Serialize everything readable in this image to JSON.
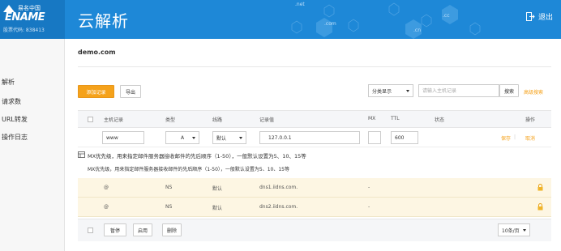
{
  "header": {
    "brand_cn": "易名中国",
    "brand_en": "ENAME",
    "stock_code": "股票代码: 838413",
    "title": "云解析",
    "deco_labels": [
      ".net",
      ".com",
      ".cc",
      ".cn"
    ],
    "logout_label": "退出",
    "bg_color": "#1e88d7"
  },
  "sidebar": {
    "items": [
      {
        "label": "解析"
      },
      {
        "label": "请求数"
      },
      {
        "label": "URL转发"
      },
      {
        "label": "操作日志"
      }
    ]
  },
  "main": {
    "domain": "demo.com",
    "toolbar": {
      "add_label": "添加记录",
      "export_label": "导出",
      "group_select": "分类显示",
      "search_placeholder": "请输入主机记录",
      "search_label": "搜索",
      "advanced_label": "高级搜索"
    },
    "columns": [
      "主机记录",
      "类型",
      "线路",
      "记录值",
      "MX",
      "TTL",
      "状态",
      "操作"
    ],
    "edit_row": {
      "host": "www",
      "type": "A",
      "line": "默认",
      "value": "127.0.0.1",
      "mx": "",
      "ttl": "600",
      "save_label": "保存",
      "cancel_label": "取消"
    },
    "hints": {
      "line1": "MX优先级，用来指定邮件服务器接收邮件的先后顺序（1-50），一般默认设置为5、10、15等",
      "line2": "MX优先级，用来指定邮件服务器接收邮件的先后顺序（1-50），一般默认设置为5、10、15等"
    },
    "rows": [
      {
        "host": "@",
        "type": "NS",
        "line": "默认",
        "value": "dns1.iidns.com.",
        "mx": "-"
      },
      {
        "host": "@",
        "type": "NS",
        "line": "默认",
        "value": "dns2.iidns.com.",
        "mx": "-"
      }
    ],
    "footer": {
      "pause_label": "暂停",
      "enable_label": "启用",
      "delete_label": "删除",
      "page_size": "10条/页"
    }
  },
  "colors": {
    "accent": "#f5a21b",
    "row_highlight": "#fdf6e3"
  }
}
